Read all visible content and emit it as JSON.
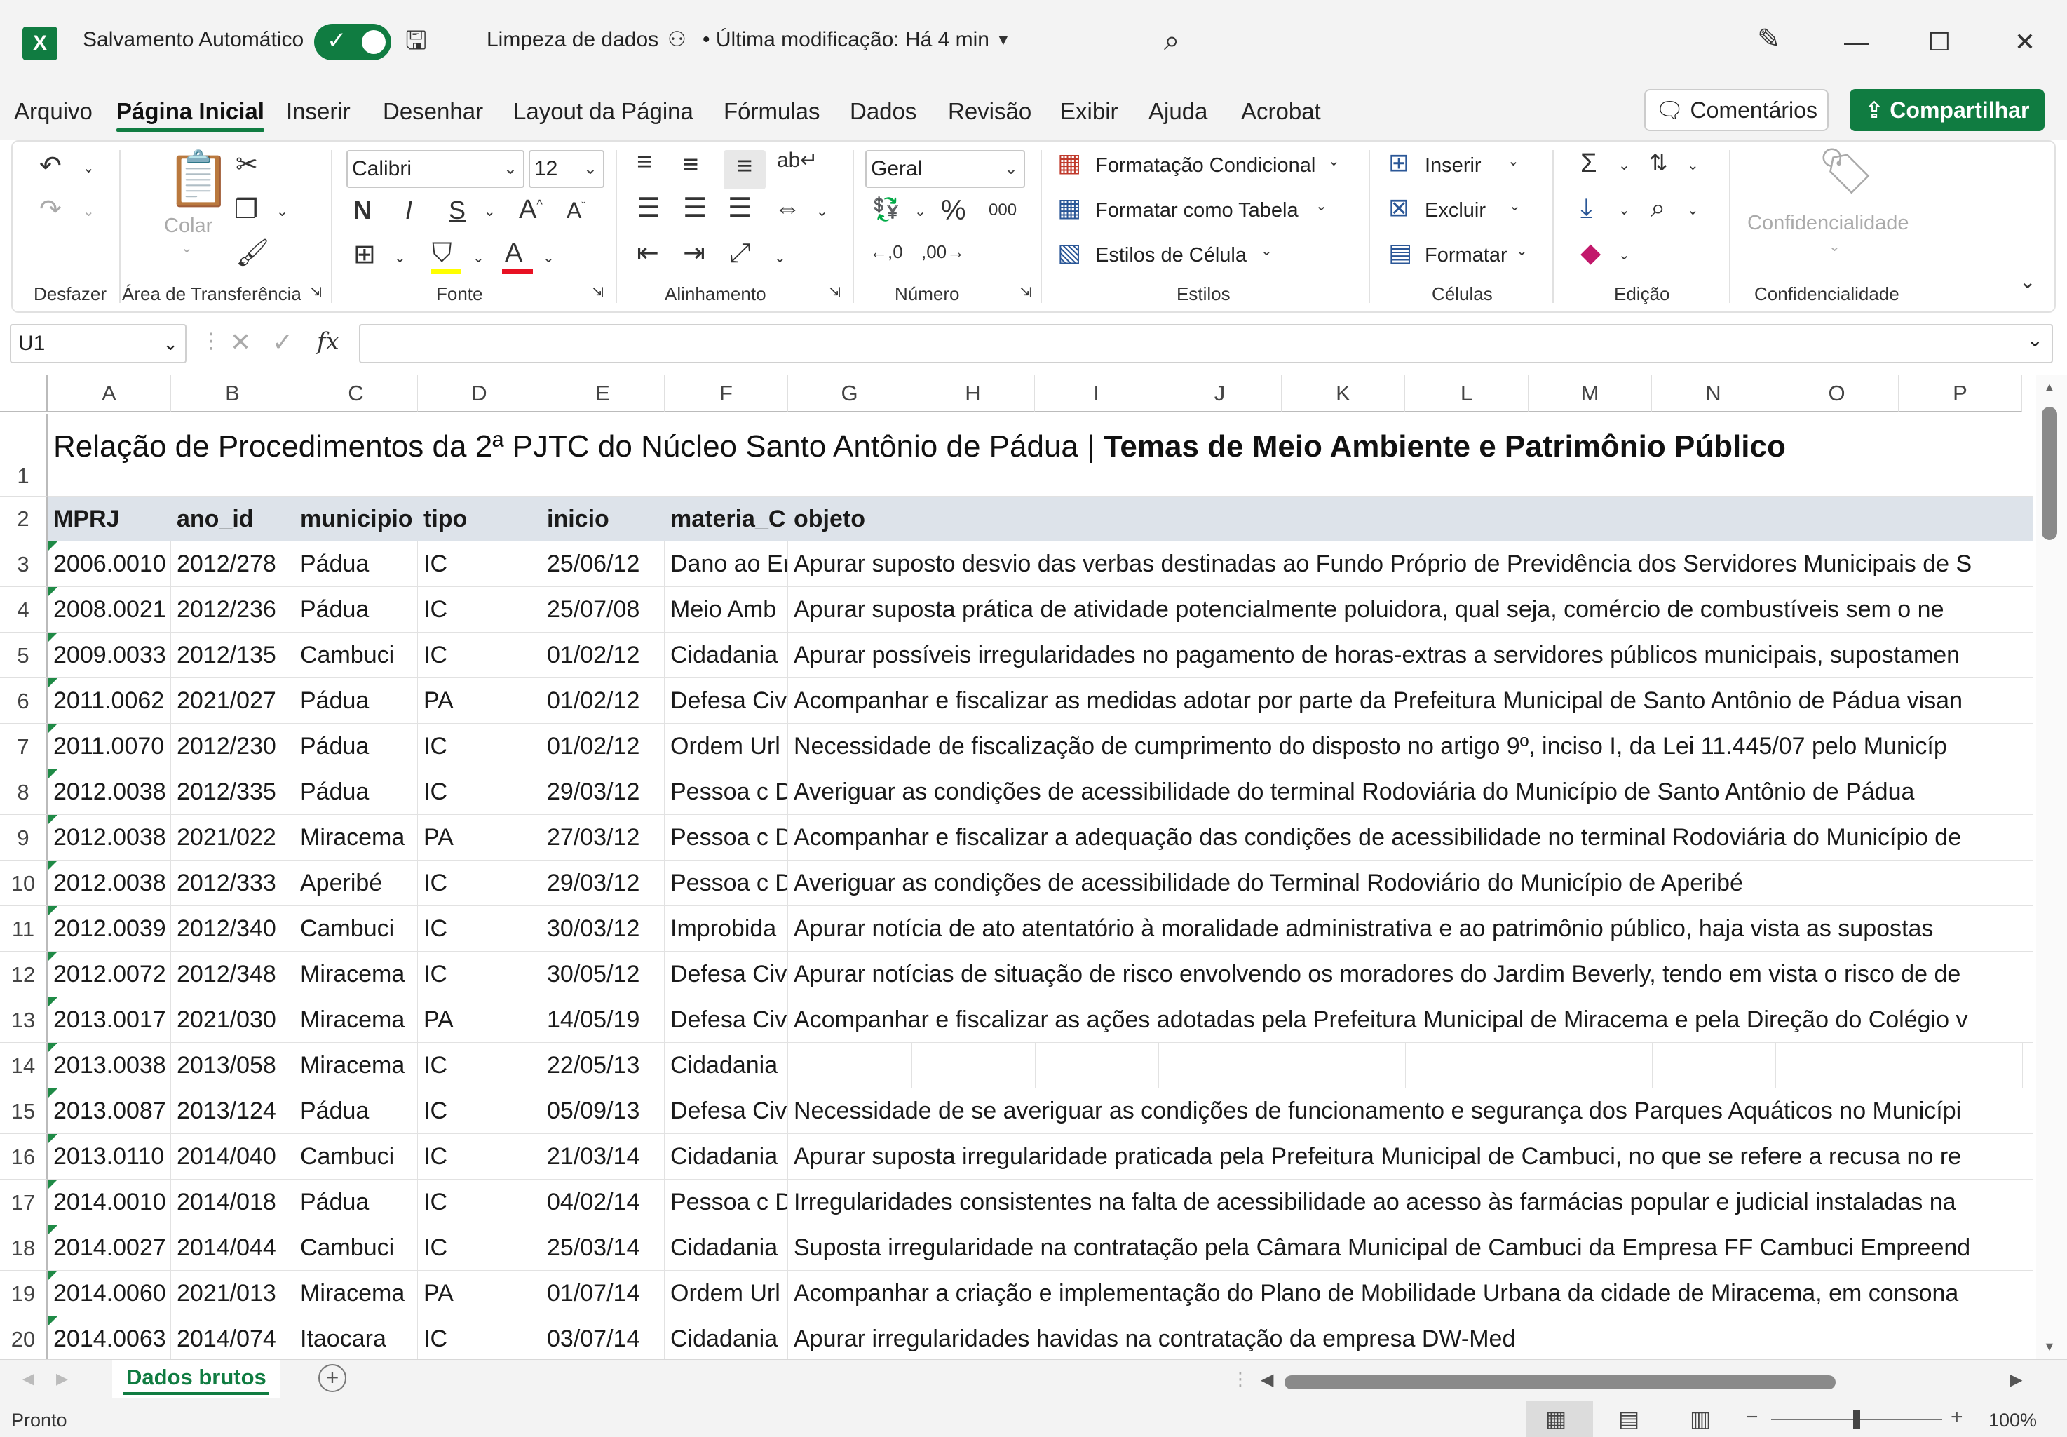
{
  "titlebar": {
    "app_icon": "excel-icon",
    "autosave_label": "Salvamento Automático",
    "autosave_on": true,
    "doc_title": "Limpeza de dados",
    "last_modified": "• Última modificação: Há 4 min"
  },
  "menu": {
    "tabs": [
      "Arquivo",
      "Página Inicial",
      "Inserir",
      "Desenhar",
      "Layout da Página",
      "Fórmulas",
      "Dados",
      "Revisão",
      "Exibir",
      "Ajuda",
      "Acrobat"
    ],
    "active_tab": "Página Inicial",
    "comments_label": "Comentários",
    "share_label": "Compartilhar"
  },
  "ribbon": {
    "groups": {
      "undo": "Desfazer",
      "clipboard": "Área de Transferência",
      "font": "Fonte",
      "alignment": "Alinhamento",
      "number": "Número",
      "styles": "Estilos",
      "cells": "Células",
      "editing": "Edição",
      "sensitivity": "Confidencialidade"
    },
    "paste_label": "Colar",
    "font_name": "Calibri",
    "font_size": "12",
    "number_format": "Geral",
    "percent": "%",
    "thousands": "000",
    "conditional_formatting": "Formatação Condicional",
    "format_as_table": "Formatar como Tabela",
    "cell_styles": "Estilos de Célula",
    "insert": "Inserir",
    "delete": "Excluir",
    "format": "Formatar",
    "sensitivity_button": "Confidencialidade",
    "font_color": "#e81123",
    "fill_color": "#ffff00"
  },
  "formula_bar": {
    "name_box": "U1",
    "fx": "fx",
    "formula": ""
  },
  "columns": [
    "A",
    "B",
    "C",
    "D",
    "E",
    "F",
    "G",
    "H",
    "I",
    "J",
    "K",
    "L",
    "M",
    "N",
    "O",
    "P"
  ],
  "title_row": {
    "normal": "Relação de Procedimentos da 2ª PJTC do Núcleo Santo Antônio de Pádua | ",
    "bold": "Temas de Meio Ambiente e Patrimônio Público"
  },
  "headers": [
    "MPRJ",
    "ano_id",
    "municipio",
    "tipo",
    "inicio",
    "materia_C",
    "objeto"
  ],
  "rows": [
    [
      "2006.0010",
      "2012/278",
      "Pádua",
      "IC",
      "25/06/12",
      "Dano ao Er",
      "Apurar suposto desvio das verbas destinadas ao Fundo Próprio de Previdência dos Servidores Municipais de S"
    ],
    [
      "2008.0021",
      "2012/236",
      "Pádua",
      "IC",
      "25/07/08",
      "Meio Amb",
      "Apurar suposta prática de atividade potencialmente poluidora, qual seja, comércio de combustíveis sem o ne"
    ],
    [
      "2009.0033",
      "2012/135",
      "Cambuci",
      "IC",
      "01/02/12",
      "Cidadania",
      "Apurar possíveis irregularidades no pagamento de horas-extras a servidores públicos municipais, supostamen"
    ],
    [
      "2011.0062",
      "2021/027",
      "Pádua",
      "PA",
      "01/02/12",
      "Defesa Civ",
      "Acompanhar e fiscalizar as medidas adotar por parte da Prefeitura Municipal de Santo Antônio de Pádua visan"
    ],
    [
      "2011.0070",
      "2012/230",
      "Pádua",
      "IC",
      "01/02/12",
      "Ordem Url",
      "Necessidade de fiscalização de cumprimento do disposto no artigo 9º, inciso I, da Lei 11.445/07 pelo Municíp"
    ],
    [
      "2012.0038",
      "2012/335",
      "Pádua",
      "IC",
      "29/03/12",
      "Pessoa c D",
      "Averiguar as condições de acessibilidade do terminal Rodoviária do Município de Santo Antônio de Pádua"
    ],
    [
      "2012.0038",
      "2021/022",
      "Miracema",
      "PA",
      "27/03/12",
      "Pessoa c D",
      "Acompanhar e fiscalizar a adequação das condições de acessibilidade no terminal Rodoviária do Município de"
    ],
    [
      "2012.0038",
      "2012/333",
      "Aperibé",
      "IC",
      "29/03/12",
      "Pessoa c D",
      "Averiguar as condições de acessibilidade do Terminal Rodoviário do Município de Aperibé"
    ],
    [
      "2012.0039",
      "2012/340",
      "Cambuci",
      "IC",
      "30/03/12",
      "Improbida",
      "Apurar notícia de ato atentatório à moralidade administrativa e ao patrimônio público, haja vista as supostas"
    ],
    [
      "2012.0072",
      "2012/348",
      "Miracema",
      "IC",
      "30/05/12",
      "Defesa Civ",
      "Apurar notícias de situação de risco envolvendo os moradores do Jardim Beverly, tendo em vista o risco de de"
    ],
    [
      "2013.0017",
      "2021/030",
      "Miracema",
      "PA",
      "14/05/19",
      "Defesa Civ",
      "Acompanhar e fiscalizar as ações adotadas pela Prefeitura Municipal de Miracema e pela Direção do Colégio v"
    ],
    [
      "2013.0038",
      "2013/058",
      "Miracema",
      "IC",
      "22/05/13",
      "Cidadania",
      ""
    ],
    [
      "2013.0087",
      "2013/124",
      "Pádua",
      "IC",
      "05/09/13",
      "Defesa Civ",
      "Necessidade de se averiguar as condições de funcionamento e segurança dos Parques Aquáticos no Municípi"
    ],
    [
      "2013.0110",
      "2014/040",
      "Cambuci",
      "IC",
      "21/03/14",
      "Cidadania",
      "Apurar suposta irregularidade praticada pela Prefeitura Municipal de Cambuci, no que se refere a recusa no re"
    ],
    [
      "2014.0010",
      "2014/018",
      "Pádua",
      "IC",
      "04/02/14",
      "Pessoa c D",
      "Irregularidades consistentes na falta de acessibilidade ao acesso às farmácias popular e judicial instaladas na"
    ],
    [
      "2014.0027",
      "2014/044",
      "Cambuci",
      "IC",
      "25/03/14",
      "Cidadania",
      "Suposta irregularidade na contratação pela Câmara Municipal de Cambuci da Empresa FF Cambuci Empreend"
    ],
    [
      "2014.0060",
      "2021/013",
      "Miracema",
      "PA",
      "01/07/14",
      "Ordem Url",
      "Acompanhar a criação e implementação do Plano de Mobilidade Urbana da cidade de Miracema, em consona"
    ],
    [
      "2014.0063",
      "2014/074",
      "Itaocara",
      "IC",
      "03/07/14",
      "Cidadania",
      "Apurar irregularidades havidas na contratação da empresa DW-Med"
    ]
  ],
  "sheet_tabs": [
    "Dados brutos"
  ],
  "status": {
    "text": "Pronto",
    "zoom": "100%",
    "zoom_level": 0.5
  }
}
